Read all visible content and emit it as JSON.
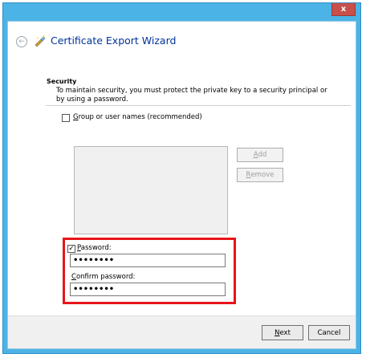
{
  "window": {
    "close_glyph": "x",
    "title": "Certificate Export Wizard"
  },
  "section": {
    "heading": "Security",
    "description": "To maintain security, you must protect the private key to a security principal or by using a password."
  },
  "group_option": {
    "checked": false,
    "label_underlined": "G",
    "label_rest": "roup or user names (recommended)"
  },
  "side_buttons": {
    "add_u": "A",
    "add_rest": "dd",
    "remove_u": "R",
    "remove_rest": "emove"
  },
  "password_option": {
    "checked": true,
    "check_glyph": "✓",
    "label_underlined": "P",
    "label_rest": "assword:",
    "value": "••••••••"
  },
  "confirm": {
    "label_underlined": "C",
    "label_rest": "onfirm password:",
    "value": "••••••••"
  },
  "footer": {
    "next_u": "N",
    "next_rest": "ext",
    "cancel_label": "Cancel"
  },
  "icons": {
    "back": "back-arrow-icon",
    "wizard": "certificate-wizard-icon",
    "close": "close-icon"
  },
  "colors": {
    "title_text": "#003399",
    "frame": "#4cb3e6",
    "close_button": "#c7504a",
    "highlight_box": "#e8141a"
  }
}
